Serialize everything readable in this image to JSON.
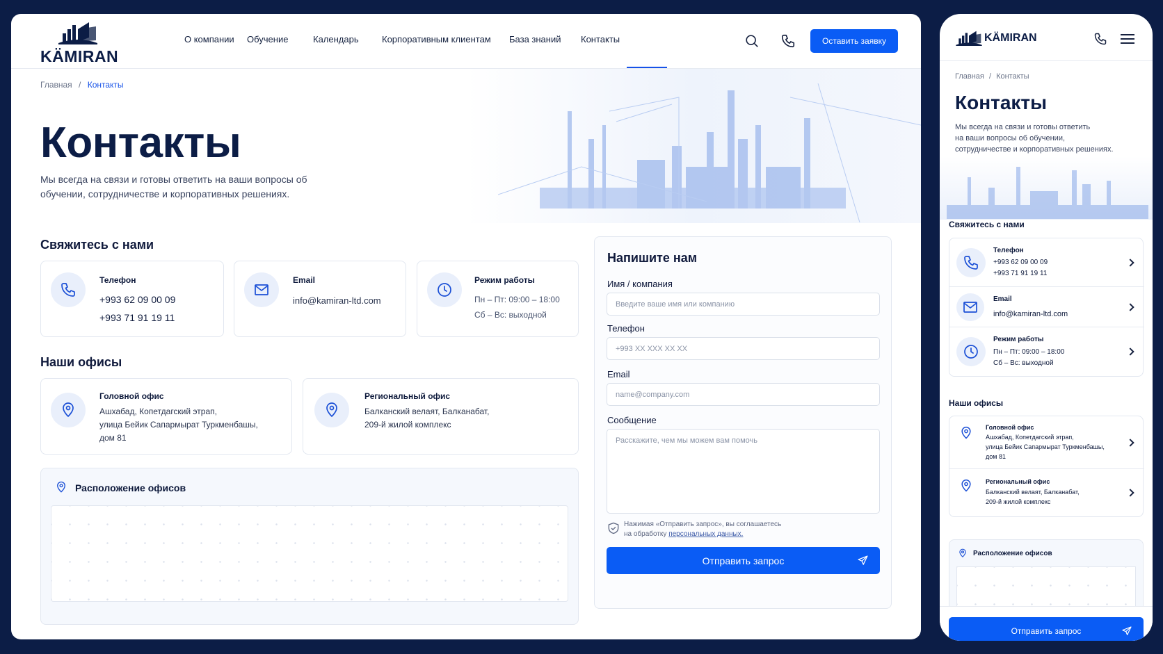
{
  "brand": {
    "name": "KÄMIRAN"
  },
  "nav": {
    "items": [
      "О компании",
      "Обучение",
      "Календарь",
      "Корпоративным клиентам",
      "База знаний",
      "Контакты"
    ],
    "cta": "Оставить заявку"
  },
  "breadcrumb": {
    "home": "Главная",
    "sep": "/",
    "current": "Контакты"
  },
  "hero": {
    "title": "Контакты",
    "subtitle": "Мы всегда на связи и готовы ответить на ваши вопросы об обучении, сотрудничестве и корпоративных решениях."
  },
  "contact": {
    "heading": "Свяжитесь с нами",
    "phone_label": "Телефон",
    "phone1": "+993 62 09 00 09",
    "phone2": "+993 71 91 19 11",
    "email_label": "Email",
    "email": "info@kamiran-ltd.com",
    "hours_label": "Режим работы",
    "hours1": "Пн – Пт: 09:00 – 18:00",
    "hours2": "Сб – Вс: выходной"
  },
  "offices": {
    "heading": "Наши офисы",
    "main_label": "Головной офис",
    "main_addr1": "Ашхабад, Копетдагский этрап,",
    "main_addr2": "улица Бейик Сапармырат Туркменбашы,",
    "main_addr3": "дом 81",
    "reg_label": "Региональный офис",
    "reg_addr1": "Балканский велаят, Балканабат,",
    "reg_addr2": "209-й жилой комплекс"
  },
  "map": {
    "title": "Расположение офисов"
  },
  "form": {
    "title": "Напишите нам",
    "name_label": "Имя / компания",
    "name_placeholder": "Введите ваше имя или компанию",
    "phone_label": "Телефон",
    "phone_placeholder": "+993 XX XXX XX XX",
    "email_label": "Email",
    "email_placeholder": "name@company.com",
    "message_label": "Сообщение",
    "message_placeholder": "Расскажите, чем мы можем вам помочь",
    "consent1": "Нажимая «Отправить запрос», вы соглашаетесь",
    "consent2": "на обработку",
    "consent_link": "персональных данных.",
    "submit": "Отправить запрос"
  },
  "mobile": {
    "subtitle1": "Мы всегда на связи и готовы ответить",
    "subtitle2": "на ваши вопросы об обучении,",
    "subtitle3": "сотрудничестве и корпоративных решениях."
  },
  "colors": {
    "accent": "#0a5cf5",
    "navy": "#0c1d46",
    "icon_bg": "#e9effb"
  }
}
